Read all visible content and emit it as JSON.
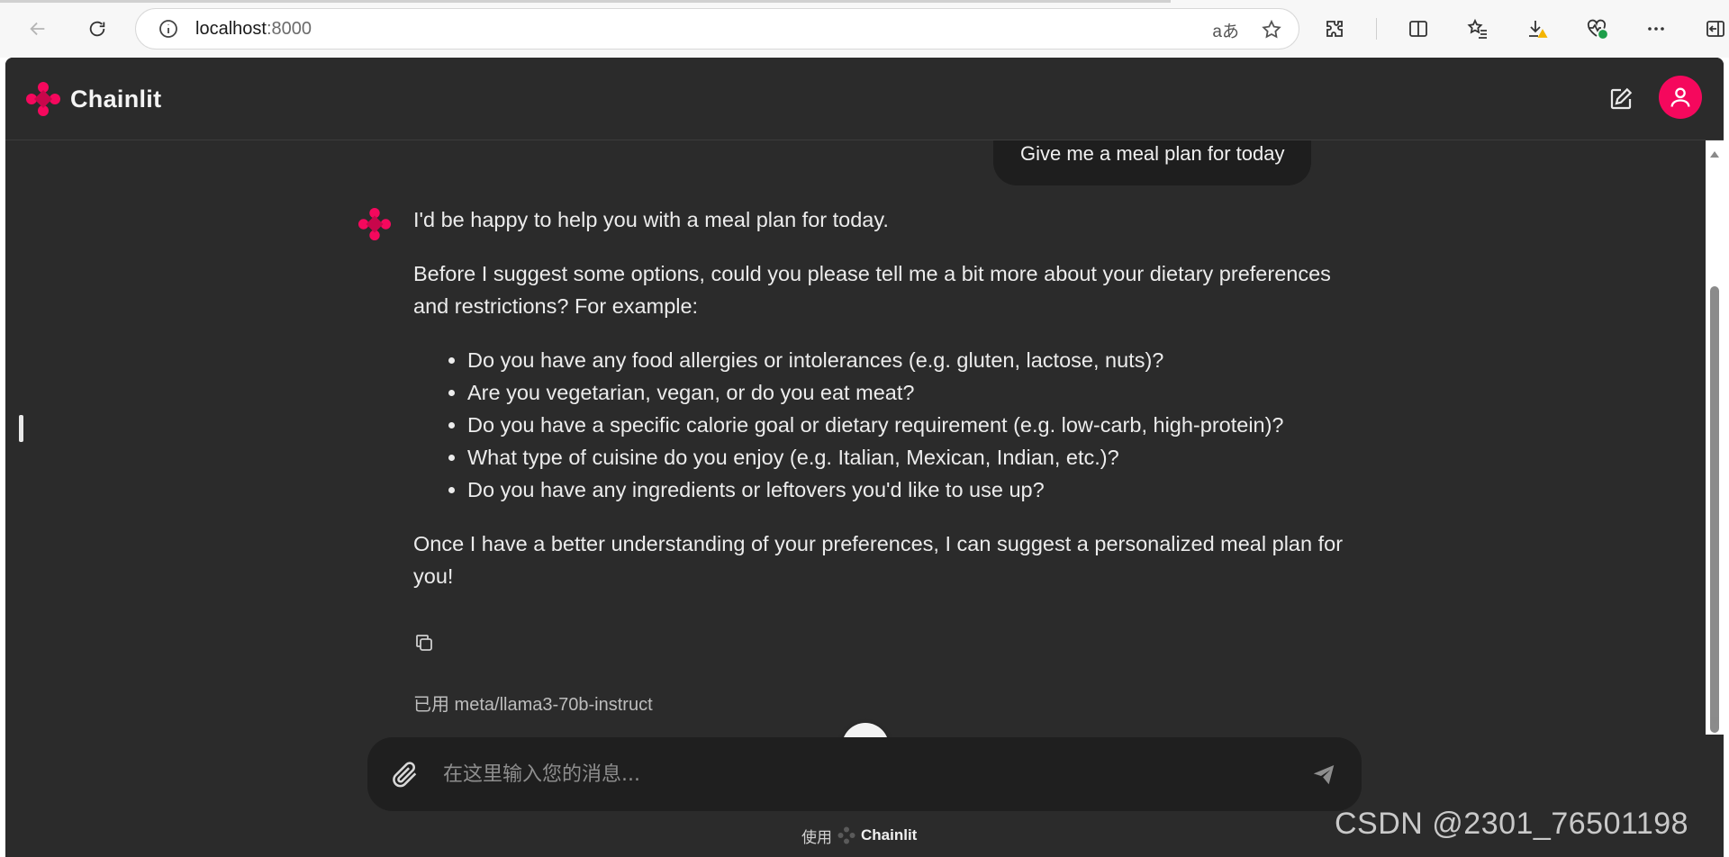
{
  "browser": {
    "url_host": "localhost",
    "url_port": ":8000",
    "read_aloud_label": "aあ"
  },
  "app": {
    "brand_name": "Chainlit",
    "accent_color": "#f5085d"
  },
  "chat": {
    "user_message": "Give me a meal plan for today",
    "assistant": {
      "intro": "I'd be happy to help you with a meal plan for today.",
      "question": "Before I suggest some options, could you please tell me a bit more about your dietary preferences and restrictions? For example:",
      "list": [
        "Do you have any food allergies or intolerances (e.g. gluten, lactose, nuts)?",
        "Are you vegetarian, vegan, or do you eat meat?",
        "Do you have a specific calorie goal or dietary requirement (e.g. low-carb, high-protein)?",
        "What type of cuisine do you enjoy (e.g. Italian, Mexican, Indian, etc.)?",
        "Do you have any ingredients or leftovers you'd like to use up?"
      ],
      "closing": "Once I have a better understanding of your preferences, I can suggest a personalized meal plan for you!"
    },
    "model_note": "已用 meta/llama3-70b-instruct"
  },
  "composer": {
    "placeholder": "在这里输入您的消息..."
  },
  "footer": {
    "prefix": "使用",
    "name": "Chainlit"
  },
  "watermark": "CSDN @2301_76501198"
}
